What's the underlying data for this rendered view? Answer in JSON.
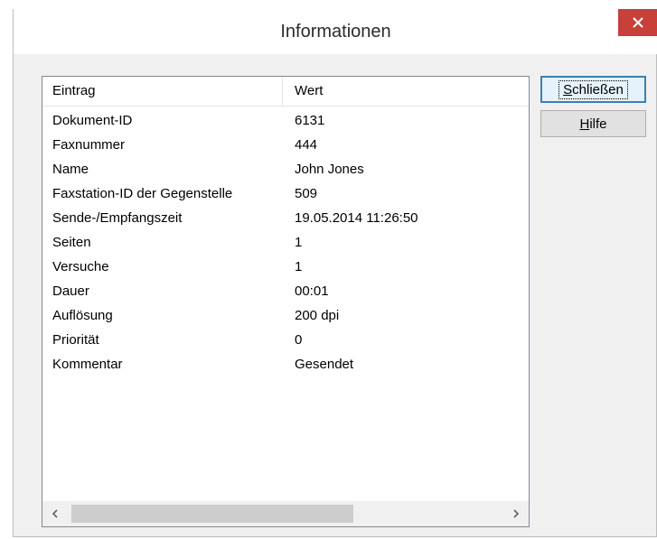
{
  "window": {
    "title": "Informationen"
  },
  "list": {
    "columns": [
      "Eintrag",
      "Wert"
    ],
    "rows": [
      {
        "key": "Dokument-ID",
        "value": "6131"
      },
      {
        "key": "Faxnummer",
        "value": "444"
      },
      {
        "key": "Name",
        "value": "John Jones"
      },
      {
        "key": "Faxstation-ID der Gegenstelle",
        "value": "509"
      },
      {
        "key": "Sende-/Empfangszeit",
        "value": "19.05.2014 11:26:50"
      },
      {
        "key": "Seiten",
        "value": "1"
      },
      {
        "key": "Versuche",
        "value": "1"
      },
      {
        "key": "Dauer",
        "value": "00:01"
      },
      {
        "key": "Auflösung",
        "value": "200 dpi"
      },
      {
        "key": "Priorität",
        "value": "0"
      },
      {
        "key": "Kommentar",
        "value": "Gesendet"
      }
    ]
  },
  "buttons": {
    "close": {
      "accel": "S",
      "rest": "chließen"
    },
    "help": {
      "accel": "H",
      "rest": "ilfe"
    }
  },
  "icons": {
    "close": "close-icon",
    "scroll_left": "chevron-left-icon",
    "scroll_right": "chevron-right-icon"
  },
  "colors": {
    "close_button": "#c7403a",
    "primary_border": "#3c7fb1"
  }
}
